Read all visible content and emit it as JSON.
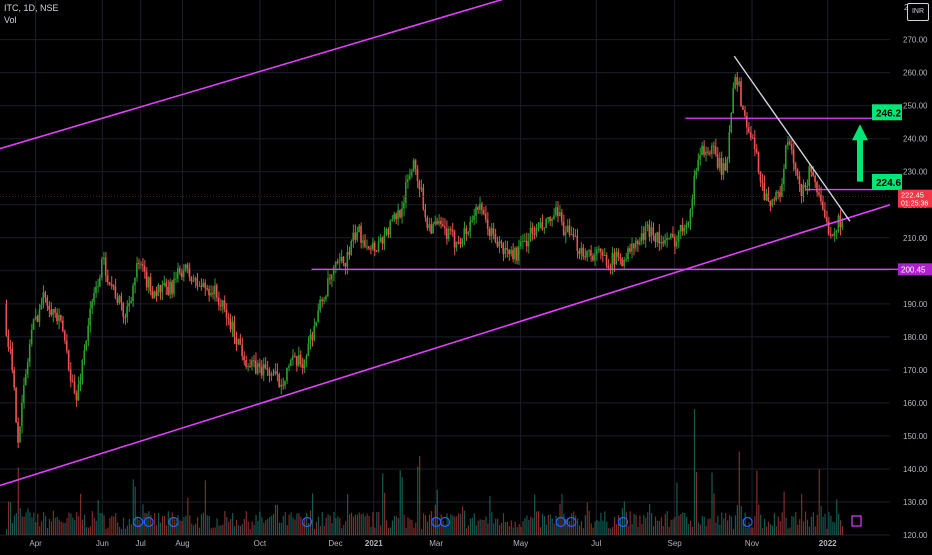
{
  "header": {
    "symbol_line": "ITC, 1D, NSE",
    "volume_label": "Vol",
    "currency_badge": "INR"
  },
  "colors": {
    "up": "#26a69a",
    "up_candle": "#2ca02c",
    "down": "#ef5350",
    "channel": "#e040fb",
    "trendline": "#d1d4dc",
    "grid": "#1b1f2b",
    "text": "#b2b5be",
    "target_fill": "#00e676",
    "price_red": "#f23645"
  },
  "chart_data": {
    "type": "candlestick",
    "title": "ITC, 1D, NSE",
    "ylim": [
      120,
      282
    ],
    "y_ticks": [
      "270.00",
      "260.00",
      "250.00",
      "240.00",
      "230.00",
      "220.00",
      "210.00",
      "200.00",
      "190.00",
      "180.00",
      "170.00",
      "160.00",
      "150.00",
      "140.00",
      "130.00",
      "120.00"
    ],
    "y_top_partial": "28",
    "x_labels": [
      {
        "label": "Apr",
        "t": 0.04
      },
      {
        "label": "Jun",
        "t": 0.115
      },
      {
        "label": "Jul",
        "t": 0.158
      },
      {
        "label": "Aug",
        "t": 0.205
      },
      {
        "label": "Oct",
        "t": 0.292
      },
      {
        "label": "Dec",
        "t": 0.377
      },
      {
        "label": "2021",
        "t": 0.42
      },
      {
        "label": "Mar",
        "t": 0.49
      },
      {
        "label": "May",
        "t": 0.585
      },
      {
        "label": "Jul",
        "t": 0.67
      },
      {
        "label": "Sep",
        "t": 0.758
      },
      {
        "label": "Nov",
        "t": 0.845
      },
      {
        "label": "2022",
        "t": 0.93
      }
    ],
    "price_path": [
      [
        0.0,
        190
      ],
      [
        0.01,
        178
      ],
      [
        0.02,
        150
      ],
      [
        0.035,
        182
      ],
      [
        0.05,
        193
      ],
      [
        0.07,
        182
      ],
      [
        0.085,
        160
      ],
      [
        0.1,
        186
      ],
      [
        0.115,
        203
      ],
      [
        0.125,
        196
      ],
      [
        0.14,
        186
      ],
      [
        0.155,
        202
      ],
      [
        0.17,
        194
      ],
      [
        0.19,
        194
      ],
      [
        0.205,
        201
      ],
      [
        0.22,
        196
      ],
      [
        0.24,
        194
      ],
      [
        0.26,
        183
      ],
      [
        0.28,
        171
      ],
      [
        0.3,
        170
      ],
      [
        0.315,
        166
      ],
      [
        0.325,
        172
      ],
      [
        0.34,
        172
      ],
      [
        0.36,
        190
      ],
      [
        0.375,
        200
      ],
      [
        0.39,
        204
      ],
      [
        0.4,
        212
      ],
      [
        0.42,
        207
      ],
      [
        0.435,
        212
      ],
      [
        0.45,
        219
      ],
      [
        0.465,
        234
      ],
      [
        0.48,
        214
      ],
      [
        0.495,
        213
      ],
      [
        0.51,
        209
      ],
      [
        0.525,
        212
      ],
      [
        0.535,
        220
      ],
      [
        0.55,
        212
      ],
      [
        0.565,
        206
      ],
      [
        0.58,
        205
      ],
      [
        0.595,
        211
      ],
      [
        0.61,
        213
      ],
      [
        0.625,
        217
      ],
      [
        0.64,
        210
      ],
      [
        0.655,
        206
      ],
      [
        0.67,
        205
      ],
      [
        0.685,
        203
      ],
      [
        0.7,
        204
      ],
      [
        0.715,
        208
      ],
      [
        0.73,
        213
      ],
      [
        0.745,
        208
      ],
      [
        0.76,
        210
      ],
      [
        0.775,
        218
      ],
      [
        0.785,
        237
      ],
      [
        0.8,
        236
      ],
      [
        0.815,
        229
      ],
      [
        0.825,
        262
      ],
      [
        0.835,
        248
      ],
      [
        0.85,
        234
      ],
      [
        0.86,
        222
      ],
      [
        0.875,
        222
      ],
      [
        0.885,
        240
      ],
      [
        0.9,
        222
      ],
      [
        0.912,
        232
      ],
      [
        0.925,
        215
      ],
      [
        0.935,
        212
      ],
      [
        0.945,
        216
      ],
      [
        0.955,
        219
      ],
      [
        0.96,
        222
      ]
    ],
    "lines": {
      "upper_channel": [
        [
          0.0,
          237
        ],
        [
          1.0,
          317
        ]
      ],
      "lower_channel": [
        [
          0.0,
          135
        ],
        [
          1.0,
          220
        ]
      ],
      "support_level": 200.45,
      "resistance_level": 246.2,
      "breakout_level": 224.6,
      "prev_close_level": 222.45,
      "downtrend": [
        [
          0.825,
          265
        ],
        [
          0.955,
          215
        ]
      ]
    },
    "annotations": {
      "target_1": "224.6",
      "target_2": "246.2",
      "support_label": "200.45",
      "price_label": "222.45",
      "countdown": "01:25:36"
    },
    "volume_spikes": [
      [
        0.01,
        0.35
      ],
      [
        0.02,
        0.5
      ],
      [
        0.03,
        0.25
      ],
      [
        0.06,
        0.22
      ],
      [
        0.09,
        0.3
      ],
      [
        0.11,
        0.28
      ],
      [
        0.15,
        0.55
      ],
      [
        0.16,
        0.22
      ],
      [
        0.21,
        0.3
      ],
      [
        0.23,
        0.4
      ],
      [
        0.26,
        0.2
      ],
      [
        0.31,
        0.32
      ],
      [
        0.35,
        0.35
      ],
      [
        0.39,
        0.3
      ],
      [
        0.43,
        0.55
      ],
      [
        0.45,
        0.65
      ],
      [
        0.47,
        0.78
      ],
      [
        0.49,
        0.4
      ],
      [
        0.52,
        0.28
      ],
      [
        0.55,
        0.3
      ],
      [
        0.6,
        0.3
      ],
      [
        0.63,
        0.38
      ],
      [
        0.66,
        0.3
      ],
      [
        0.7,
        0.32
      ],
      [
        0.73,
        0.28
      ],
      [
        0.76,
        0.38
      ],
      [
        0.78,
        1.0
      ],
      [
        0.8,
        0.55
      ],
      [
        0.83,
        0.6
      ],
      [
        0.85,
        0.5
      ],
      [
        0.88,
        0.35
      ],
      [
        0.9,
        0.3
      ],
      [
        0.92,
        0.5
      ],
      [
        0.94,
        0.3
      ]
    ]
  }
}
